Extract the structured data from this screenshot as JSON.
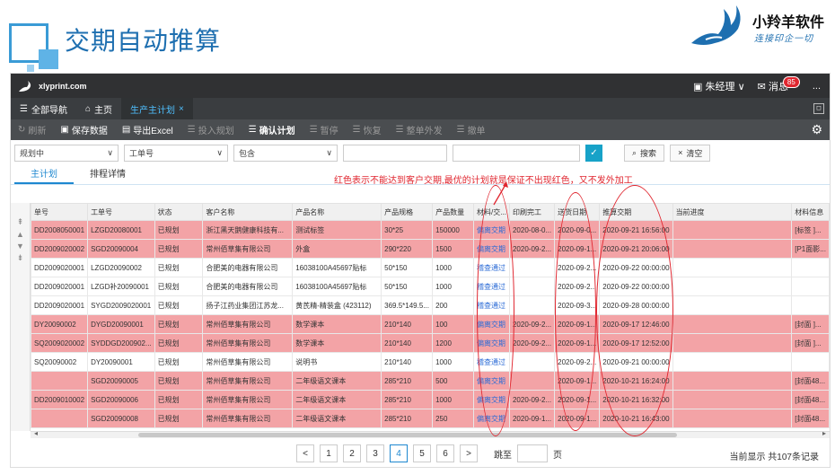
{
  "slide": {
    "title": "交期自动推算",
    "logo_name": "小羚羊软件",
    "logo_slogan": "连接印企一切"
  },
  "app": {
    "brand": "xlyprint.com",
    "user": "朱经理",
    "messages_label": "消息",
    "messages_count": "85",
    "more": "...",
    "nav": {
      "all": "全部导航",
      "home": "主页",
      "active_tab": "生产主计划"
    },
    "toolbar": {
      "refresh": "刷新",
      "save": "保存数据",
      "export": "导出Excel",
      "plan": "投入规划",
      "confirm": "确认计划",
      "pause": "暂停",
      "resume": "恢复",
      "outsource": "整单外发",
      "withdraw": "撤单"
    },
    "filters": {
      "status_value": "规划中",
      "order_placeholder": "工单号",
      "contains_value": "包含",
      "search_label": "搜索",
      "clear_label": "清空"
    },
    "annotation": "红色表示不能达到客户交期,最优的计划就是保证不出现红色，又不发外加工",
    "subtabs": [
      "主计划",
      "排程详情"
    ],
    "columns": [
      "单号",
      "工单号",
      "状态",
      "客户名称",
      "产品名称",
      "产品规格",
      "产品数量",
      "材料/交...",
      "印刷完工",
      "送货日期",
      "推算交期",
      "当前进度",
      "材料信息"
    ],
    "rows": [
      {
        "color": "red",
        "cells": [
          "DD2008050001",
          "LZGD20080001",
          "已规划",
          "浙江黑天鹅健康科技有...",
          "测试标签",
          "30*25",
          "150000",
          "偏离交期",
          "2020-08-0...",
          "2020-09-0...",
          "2020-09-21 16:56:00",
          "",
          "[标签 ]..."
        ]
      },
      {
        "color": "red",
        "cells": [
          "DD2009020002",
          "SGD20090004",
          "已规划",
          "常州佰草集有限公司",
          "外盒",
          "290*220",
          "1500",
          "偏离交期",
          "2020-09-2...",
          "2020-09-1...",
          "2020-09-21 20:06:00",
          "",
          "[P1面影..."
        ]
      },
      {
        "color": "white",
        "cells": [
          "DD2009020001",
          "LZGD20090002",
          "已规划",
          "合肥美的电器有限公司",
          "16038100A45697贴标",
          "50*150",
          "1000",
          "稽查通过",
          "",
          "2020-09-2...",
          "2020-09-22 00:00:00",
          "",
          ""
        ]
      },
      {
        "color": "white",
        "cells": [
          "DD2009020001",
          "LZGD补20090001",
          "已规划",
          "合肥美的电器有限公司",
          "16038100A45697贴标",
          "50*150",
          "1000",
          "稽查通过",
          "",
          "2020-09-2...",
          "2020-09-22 00:00:00",
          "",
          ""
        ]
      },
      {
        "color": "white",
        "cells": [
          "DD2009020001",
          "SYGD2009020001",
          "已规划",
          "扬子江药业集团江苏龙...",
          "黄芪精-精装盒 (423112)",
          "369.5*149.5...",
          "200",
          "稽查通过",
          "",
          "2020-09-3...",
          "2020-09-28 00:00:00",
          "",
          ""
        ]
      },
      {
        "color": "red",
        "cells": [
          "DY20090002",
          "DYGD20090001",
          "已规划",
          "常州佰草集有限公司",
          "数学课本",
          "210*140",
          "100",
          "偏离交期",
          "2020-09-2...",
          "2020-09-1...",
          "2020-09-17 12:46:00",
          "",
          "[封面 ]..."
        ]
      },
      {
        "color": "red",
        "cells": [
          "SQ2009020002",
          "SYDDGD200902...",
          "已规划",
          "常州佰草集有限公司",
          "数学课本",
          "210*140",
          "1200",
          "偏离交期",
          "2020-09-2...",
          "2020-09-1...",
          "2020-09-17 12:52:00",
          "",
          "[封面 ]..."
        ]
      },
      {
        "color": "white",
        "cells": [
          "SQ20090002",
          "DY20090001",
          "已规划",
          "常州佰草集有限公司",
          "说明书",
          "210*140",
          "1000",
          "稽查通过",
          "",
          "2020-09-2...",
          "2020-09-21 00:00:00",
          "",
          ""
        ]
      },
      {
        "color": "red",
        "cells": [
          "",
          "SGD20090005",
          "已规划",
          "常州佰草集有限公司",
          "二年级语文课本",
          "285*210",
          "500",
          "偏离交期",
          "",
          "2020-09-1...",
          "2020-10-21 16:24:00",
          "",
          "[封面48..."
        ]
      },
      {
        "color": "red",
        "cells": [
          "DD2009010002",
          "SGD20090006",
          "已规划",
          "常州佰草集有限公司",
          "二年级语文课本",
          "285*210",
          "1000",
          "偏离交期",
          "2020-09-2...",
          "2020-09-1...",
          "2020-10-21 16:32:00",
          "",
          "[封面48..."
        ]
      },
      {
        "color": "red",
        "cells": [
          "",
          "SGD20090008",
          "已规划",
          "常州佰草集有限公司",
          "二年级语文课本",
          "285*210",
          "250",
          "偏离交期",
          "2020-09-1...",
          "2020-09-1...",
          "2020-10-21 16:43:00",
          "",
          "[封面48..."
        ]
      }
    ],
    "pager": {
      "pages": [
        "1",
        "2",
        "3",
        "4",
        "5",
        "6"
      ],
      "current": "4",
      "jump_label": "跳至",
      "page_unit": "页",
      "total": "当前显示 共107条记录"
    }
  },
  "colors": {
    "accent": "#1e88d0",
    "late_row": "#f3a3a6",
    "annotation": "#e0262f"
  }
}
